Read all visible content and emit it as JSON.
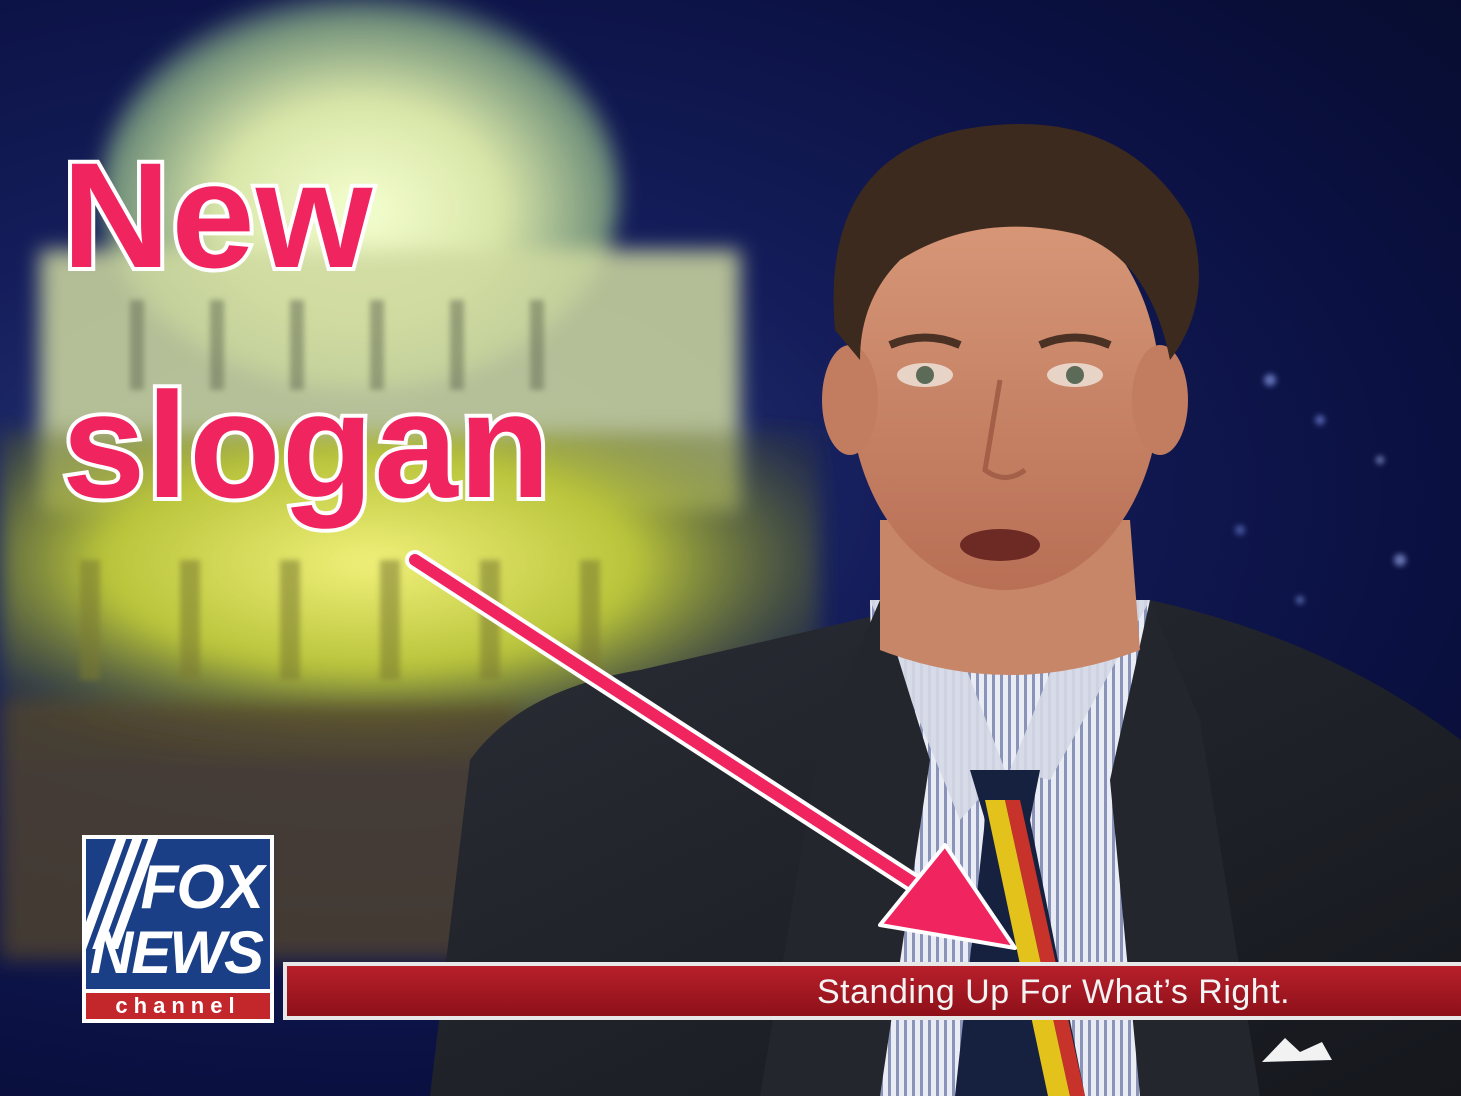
{
  "annotation": {
    "line1": "New",
    "line2": "slogan",
    "color": "#f0245e"
  },
  "logo": {
    "word1": "FOX",
    "word2": "NEWS",
    "channel": "channel",
    "blue": "#1b3f86",
    "red": "#c3262b"
  },
  "lower_third": {
    "text": "Standing Up For What’s Right.",
    "color": "#b8202b"
  },
  "icons": {
    "arrow": "arrow-icon"
  }
}
